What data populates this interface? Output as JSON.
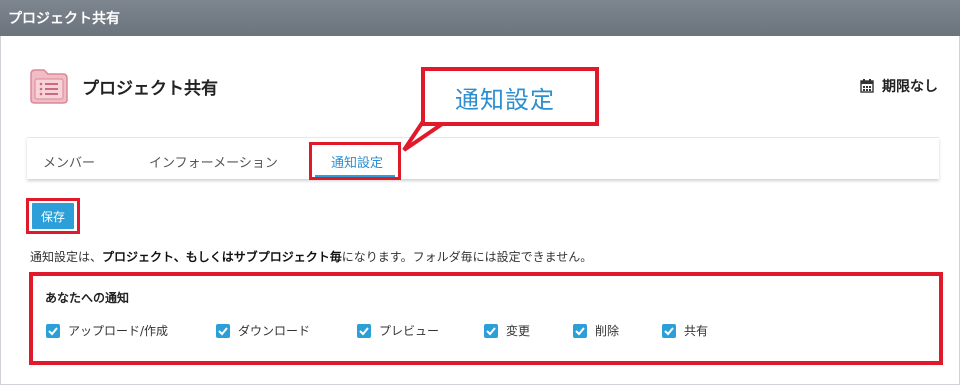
{
  "window": {
    "title": "プロジェクト共有"
  },
  "project": {
    "title": "プロジェクト共有",
    "deadline": "期限なし"
  },
  "callout": {
    "text": "通知設定"
  },
  "tabs": [
    {
      "label": "メンバー",
      "active": false
    },
    {
      "label": "インフォーメーション",
      "active": false
    },
    {
      "label": "通知設定",
      "active": true
    }
  ],
  "actions": {
    "save_label": "保存"
  },
  "description": {
    "part1": "通知設定は、",
    "bold1": "プロジェクト、もしくはサブプロジェクト毎",
    "part2": "になります。フォルダ毎には設定できません。"
  },
  "notifications": {
    "title": "あなたへの通知",
    "options": [
      {
        "label": "アップロード/作成",
        "checked": true
      },
      {
        "label": "ダウンロード",
        "checked": true
      },
      {
        "label": "プレビュー",
        "checked": true
      },
      {
        "label": "変更",
        "checked": true
      },
      {
        "label": "削除",
        "checked": true
      },
      {
        "label": "共有",
        "checked": true
      }
    ]
  },
  "colors": {
    "accent": "#2c9fd8",
    "highlight": "#e01a2a",
    "titlebar": "#737b85",
    "folder": "#e8a9b3"
  }
}
